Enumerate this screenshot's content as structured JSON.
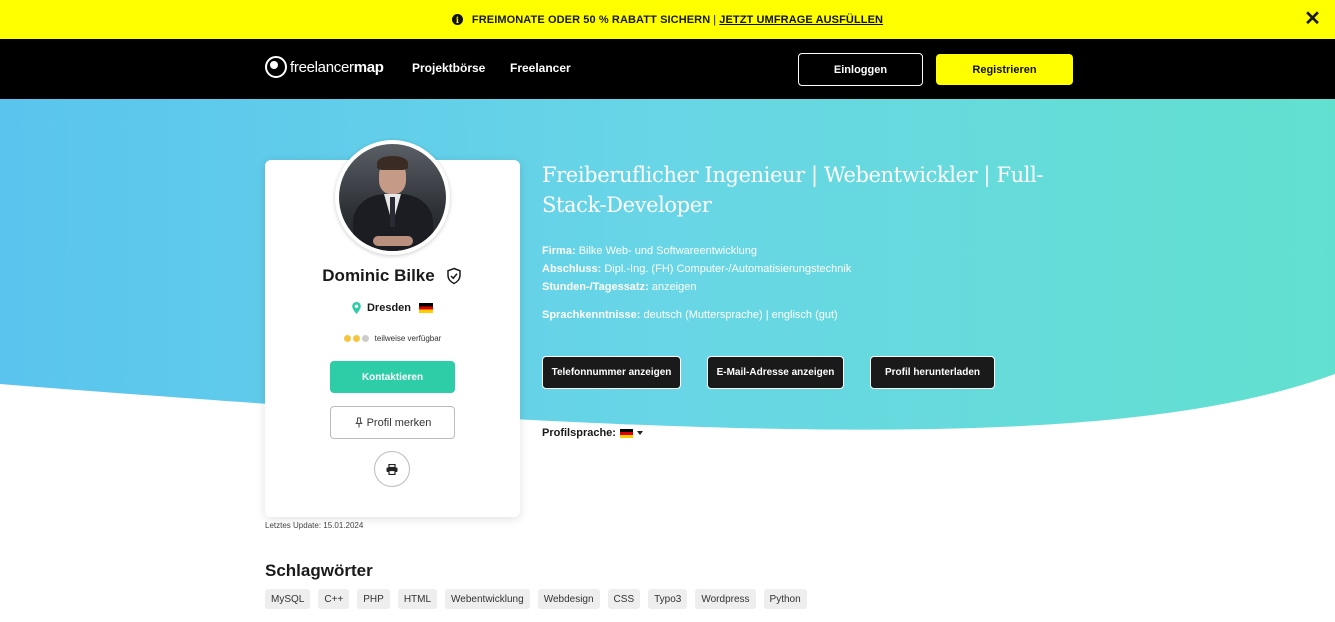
{
  "banner": {
    "text": "FREIMONATE ODER 50 % RABATT SICHERN",
    "separator": "|",
    "link": "JETZT UMFRAGE AUSFÜLLEN",
    "close": "✕"
  },
  "nav": {
    "logo_light": "freelancer",
    "logo_bold": "map",
    "links": [
      "Projektbörse",
      "Freelancer"
    ],
    "login": "Einloggen",
    "register": "Registrieren"
  },
  "profile": {
    "name": "Dominic Bilke",
    "location": "Dresden",
    "availability": "teilweise verfügbar",
    "availability_dots": [
      "#f5c542",
      "#f5c542",
      "#cccccc"
    ],
    "contact": "Kontaktieren",
    "save": "Profil merken",
    "updated": "Letztes Update: 15.01.2024"
  },
  "details": {
    "title": "Freiberuflicher Ingenieur | Webentwickler | Full-Stack-Developer",
    "company_label": "Firma:",
    "company": "Bilke Web- und Softwareentwicklung",
    "degree_label": "Abschluss:",
    "degree": "Dipl.-Ing. (FH) Computer-/Automatisierungstechnik",
    "rate_label": "Stunden-/Tagessatz:",
    "rate": "anzeigen",
    "languages_label": "Sprachkenntnisse:",
    "languages": "deutsch (Muttersprache) | englisch (gut)",
    "actions": [
      "Telefonnummer anzeigen",
      "E-Mail-Adresse anzeigen",
      "Profil herunterladen"
    ],
    "profile_language_label": "Profilsprache:"
  },
  "keywords": {
    "title": "Schlagwörter",
    "tags": [
      "MySQL",
      "C++",
      "PHP",
      "HTML",
      "Webentwicklung",
      "Webdesign",
      "CSS",
      "Typo3",
      "Wordpress",
      "Python"
    ]
  },
  "colors": {
    "banner": "#ffff00",
    "accent": "#2dcea7",
    "hero_start": "#5ec8ef",
    "hero_end": "#63e0d0"
  }
}
